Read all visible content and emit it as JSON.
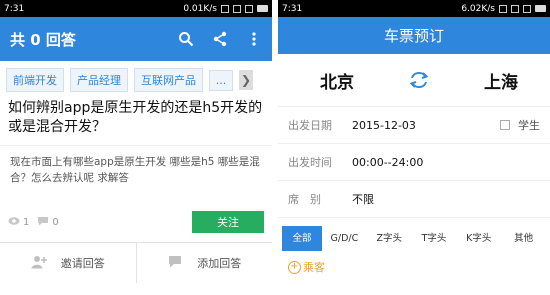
{
  "left": {
    "status": {
      "time": "7:31",
      "speed": "0.01K/s"
    },
    "appbar": {
      "title": "共 0 回答"
    },
    "tags": [
      "前端开发",
      "产品经理",
      "互联网产品",
      "..."
    ],
    "question": {
      "title": "如何辨别app是原生开发的还是h5开发的 或是混合开发？",
      "body": "现在市面上有哪些app是原生开发 哪些是h5 哪些是混合？怎么去辨认呢 求解答",
      "views": "1",
      "comments": "0",
      "follow_label": "关注"
    },
    "actions": {
      "invite_label": "邀请回答",
      "add_label": "添加回答"
    }
  },
  "right": {
    "status": {
      "time": "7:31",
      "speed": "6.02K/s"
    },
    "header_title": "车票预订",
    "from_city": "北京",
    "to_city": "上海",
    "date_label": "出发日期",
    "date_value": "2015-12-03",
    "student_label": "学生",
    "time_label": "出发时间",
    "time_value": "00:00--24:00",
    "seat_label": "席　别",
    "seat_value": "不限",
    "tabs": [
      "全部",
      "G/D/C",
      "Z字头",
      "T字头",
      "K字头",
      "其他"
    ],
    "passenger_label": "乘客"
  }
}
